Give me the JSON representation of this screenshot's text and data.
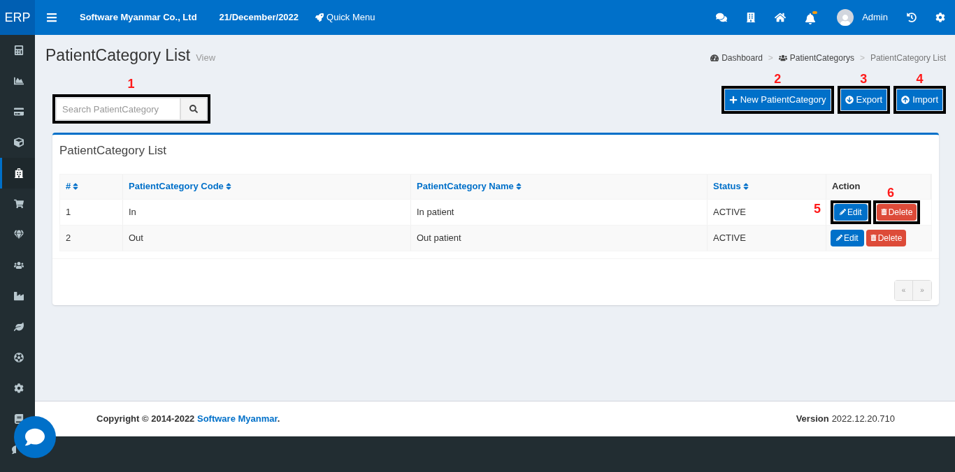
{
  "header": {
    "logo": "ERP",
    "company": "Software Myanmar Co., Ltd",
    "date": "21/December/2022",
    "quick_menu": "Quick Menu",
    "notification_dot": true,
    "user": "Admin"
  },
  "sidebar": {
    "items": [
      {
        "selected": false
      },
      {
        "selected": false
      },
      {
        "selected": false
      },
      {
        "selected": false
      },
      {
        "selected": true
      },
      {
        "selected": false
      },
      {
        "selected": false
      },
      {
        "selected": false
      },
      {
        "selected": false
      },
      {
        "selected": false
      },
      {
        "selected": false
      },
      {
        "selected": false
      },
      {
        "selected": false
      },
      {
        "selected": false
      }
    ]
  },
  "page": {
    "title": "PatientCategory List",
    "subtitle": "View"
  },
  "breadcrumb": [
    "Dashboard",
    "PatientCategorys",
    "PatientCategory List"
  ],
  "breadcrumb_separator": ">",
  "search": {
    "placeholder": "Search PatientCategory",
    "callout": "1"
  },
  "actions": [
    {
      "kind": "new",
      "label": "New PatientCategory",
      "callout": "2"
    },
    {
      "kind": "export",
      "label": "Export",
      "callout": "3"
    },
    {
      "kind": "import",
      "label": "Import",
      "callout": "4"
    }
  ],
  "panel": {
    "title": "PatientCategory List"
  },
  "table": {
    "columns": [
      {
        "label": "#",
        "sortable": true
      },
      {
        "label": "PatientCategory Code",
        "sortable": true
      },
      {
        "label": "PatientCategory Name",
        "sortable": true
      },
      {
        "label": "Status",
        "sortable": true
      },
      {
        "label": "Action",
        "sortable": false
      }
    ],
    "rows": [
      {
        "cells": [
          "1",
          "In",
          "In patient",
          "ACTIVE"
        ],
        "edit": {
          "label": "Edit",
          "callout": "5"
        },
        "delete": {
          "label": "Delete",
          "callout": "6"
        }
      },
      {
        "cells": [
          "2",
          "Out",
          "Out patient",
          "ACTIVE"
        ],
        "edit": {
          "label": "Edit"
        },
        "delete": {
          "label": "Delete"
        }
      }
    ]
  },
  "pagination": {
    "prev": "«",
    "next": "»"
  },
  "footer": {
    "copyright": "Copyright © 2014-2022 ",
    "company_link": "Software Myanmar",
    "period": ".",
    "version_label": "Version",
    "version": "2022.12.20.710"
  }
}
